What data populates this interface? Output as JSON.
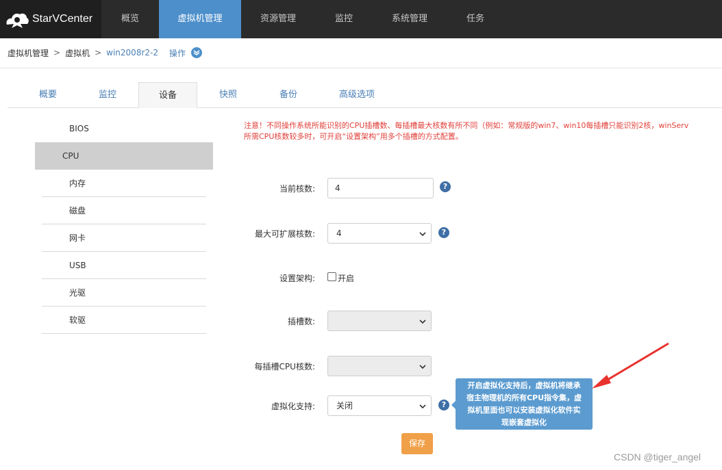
{
  "brand": {
    "name": "StarVCenter"
  },
  "nav": [
    "概览",
    "虚拟机管理",
    "资源管理",
    "监控",
    "系统管理",
    "任务"
  ],
  "nav_active_index": 1,
  "breadcrumb": {
    "root": "虚拟机管理",
    "sep1": ">",
    "level2": "虚拟机",
    "sep2": ">",
    "vm": "win2008r2-2",
    "ops": "操作"
  },
  "tabs": [
    "概要",
    "监控",
    "设备",
    "快照",
    "备份",
    "高级选项"
  ],
  "active_tab": "设备",
  "side_menu": [
    "BIOS",
    "CPU",
    "内存",
    "磁盘",
    "网卡",
    "USB",
    "光驱",
    "软驱"
  ],
  "active_side": "CPU",
  "notice": {
    "line1": "注意！不同操作系统所能识别的CPU插槽数、每插槽最大核数有所不同（例如：常规版的win7、win10每插槽只能识别2核，winServ",
    "line2": "所需CPU核数较多时，可开启“设置架构”用多个插槽的方式配置。"
  },
  "form": {
    "current_cores_label": "当前核数:",
    "current_cores_value": "4",
    "max_cores_label": "最大可扩展核数:",
    "max_cores_value": "4",
    "arch_label": "设置架构:",
    "arch_checkbox_label": "开启",
    "sockets_label": "插槽数:",
    "sockets_value": "",
    "cores_per_socket_label": "每插槽CPU核数:",
    "cores_per_socket_value": "",
    "virt_label": "虚拟化支持:",
    "virt_value": "关闭",
    "help_glyph": "?"
  },
  "save_label": "保存",
  "tooltip": {
    "line1": "开启虚拟化支持后，虚拟机将继承",
    "line2": "宿主物理机的所有CPU指令集，虚",
    "line3": "拟机里面也可以安装虚拟化软件实",
    "line4": "现嵌套虚拟化"
  },
  "annotation_color": "#e8322e",
  "watermark": "CSDN @tiger_angel"
}
